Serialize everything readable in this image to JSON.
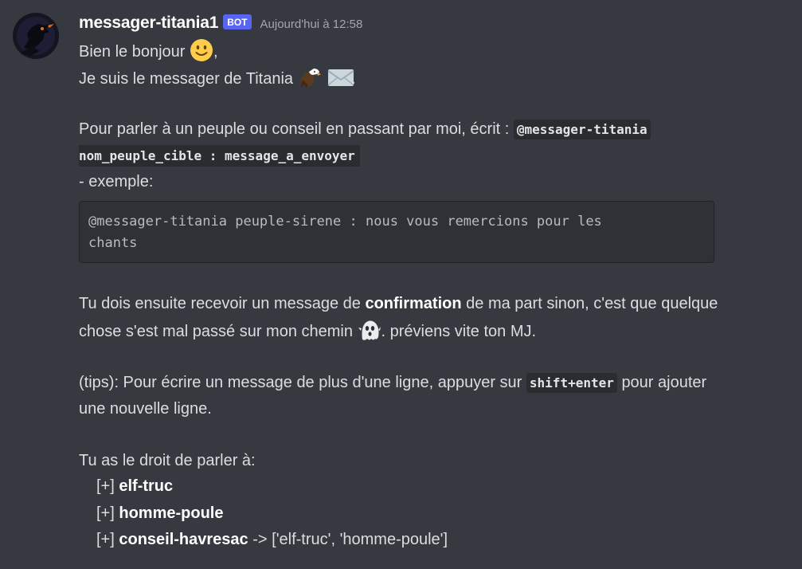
{
  "message": {
    "author": "messager-titania1",
    "badge": "BOT",
    "timestamp": "Aujourd'hui à 12:58",
    "line1": "Bien le bonjour",
    "line1_end": ",",
    "line2": "Je suis le messager de Titania",
    "line2_end": ".",
    "para1_prefix": "Pour parler à un peuple ou conseil en passant par moi, écrit :",
    "para1_code1": "@messager-titania",
    "para1_code2": "nom_peuple_cible : message_a_envoyer",
    "para1_example": "- exemple:",
    "codeblock": "@messager-titania peuple-sirene : nous vous remercions pour les\nchants",
    "para2_a": "Tu dois ensuite recevoir un message de",
    "para2_bold": "confirmation",
    "para2_b": "de ma part sinon, c'est que quelque",
    "para2_c": "chose s'est mal passé sur mon chemin",
    "para2_d": ". préviens vite ton MJ.",
    "tips_a": "(tips): Pour écrire un message de plus d'une ligne, appuyer sur",
    "tips_code": "shift+enter",
    "tips_b": "pour ajouter",
    "tips_c": "une nouvelle ligne.",
    "rights_intro": "Tu as le droit de parler à:",
    "rights": [
      {
        "prefix": "[+]",
        "name": "elf-truc",
        "suffix": ""
      },
      {
        "prefix": "[+]",
        "name": "homme-poule",
        "suffix": ""
      },
      {
        "prefix": "[+]",
        "name": "conseil-havresac",
        "suffix": "-> ['elf-truc', 'homme-poule']"
      }
    ]
  },
  "emojis": [
    "smiley-emoji",
    "eagle-emoji",
    "envelope-emoji",
    "ghost-emoji"
  ],
  "colors": {
    "background": "#36393f",
    "username": "#ffffff",
    "badge": "#5865f2",
    "timestamp": "#a3a6aa",
    "text": "#dcddde",
    "codeblock_bg": "#2f3136"
  }
}
